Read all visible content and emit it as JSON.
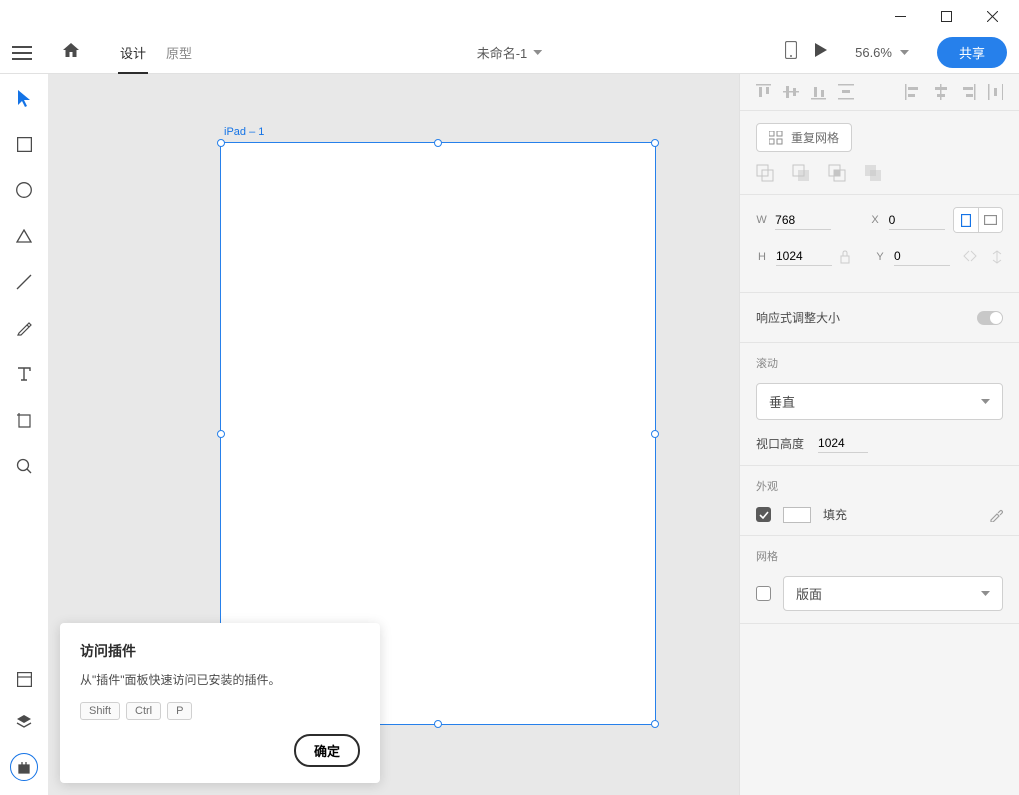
{
  "topbar": {
    "tab_design": "设计",
    "tab_prototype": "原型",
    "doc_title": "未命名-1",
    "zoom": "56.6%",
    "share": "共享"
  },
  "artboard": {
    "label": "iPad – 1"
  },
  "tooltip": {
    "title": "访问插件",
    "body": "从\"插件\"面板快速访问已安装的插件。",
    "keys": [
      "Shift",
      "Ctrl",
      "P"
    ],
    "ok": "确定"
  },
  "panel": {
    "repeat_grid": "重复网格",
    "w_label": "W",
    "w_val": "768",
    "h_label": "H",
    "h_val": "1024",
    "x_label": "X",
    "x_val": "0",
    "y_label": "Y",
    "y_val": "0",
    "responsive": "响应式调整大小",
    "scroll_title": "滚动",
    "scroll_value": "垂直",
    "viewport_label": "视口高度",
    "viewport_val": "1024",
    "appearance_title": "外观",
    "fill_label": "填充",
    "grid_title": "网格",
    "grid_value": "版面"
  }
}
